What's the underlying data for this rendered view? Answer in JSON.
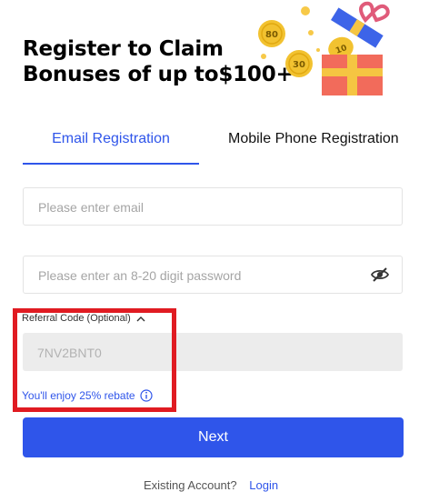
{
  "header": {
    "title_line1": "Register to Claim",
    "title_line2": "Bonuses of up to$100+",
    "coin_labels": [
      "80",
      "30",
      "10"
    ]
  },
  "tabs": {
    "email": "Email Registration",
    "mobile": "Mobile Phone Registration"
  },
  "form": {
    "email_placeholder": "Please enter email",
    "password_placeholder": "Please enter an 8-20 digit password",
    "referral_label": "Referral Code (Optional)",
    "referral_value": "7NV2BNT0",
    "rebate_text": "You'll enjoy 25% rebate",
    "next_label": "Next"
  },
  "footer": {
    "existing_account": "Existing Account?",
    "login_label": "Login"
  },
  "colors": {
    "accent": "#2f55ea",
    "highlight": "#e01b22"
  }
}
